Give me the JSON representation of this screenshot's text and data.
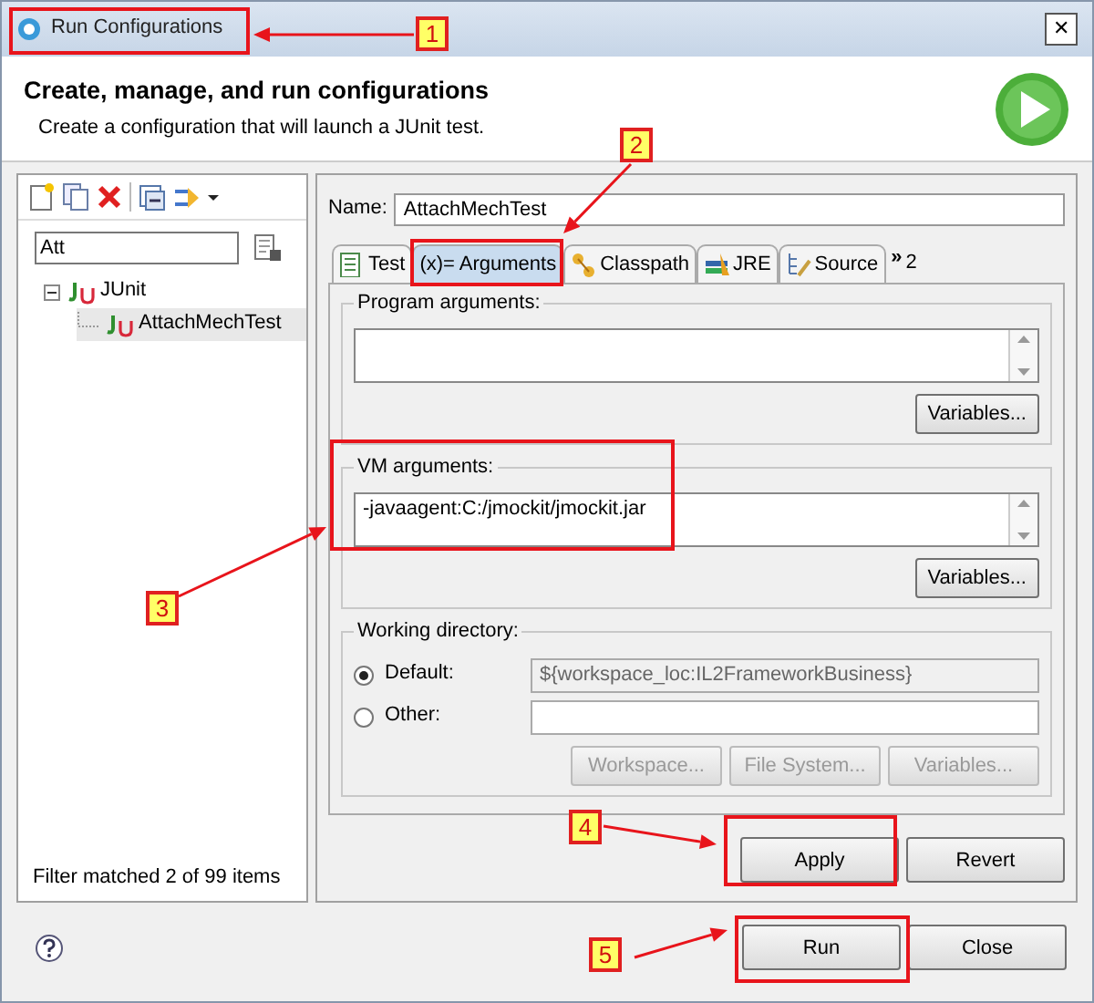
{
  "window": {
    "title": "Run Configurations",
    "close": "✕"
  },
  "header": {
    "title": "Create, manage, and run configurations",
    "description": "Create a configuration that will launch a JUnit test."
  },
  "sidebar": {
    "filter": {
      "value": "Att"
    },
    "tree": [
      {
        "label": "JUnit",
        "expanded": true,
        "selected": false,
        "children": [
          {
            "label": "AttachMechTest",
            "selected": true
          }
        ]
      }
    ],
    "status": "Filter matched 2 of 99 items"
  },
  "name": {
    "label": "Name:",
    "value": "AttachMechTest"
  },
  "tabs": [
    {
      "label": "Test",
      "selected": false
    },
    {
      "label": "(x)= Arguments",
      "selected": true
    },
    {
      "label": "Classpath",
      "selected": false
    },
    {
      "label": "JRE",
      "selected": false
    },
    {
      "label": "Source",
      "selected": false
    }
  ],
  "tabs_overflow": {
    "mark": "»",
    "count": "2"
  },
  "program_arguments": {
    "label": "Program arguments:",
    "button": "Variables..."
  },
  "vm_arguments": {
    "label": "VM arguments:",
    "value": "-javaagent:C:/jmockit/jmockit.jar",
    "button": "Variables..."
  },
  "working_directory": {
    "label": "Working directory:",
    "options": [
      {
        "label": "Default:",
        "selected": true,
        "value": "${workspace_loc:IL2FrameworkBusiness}",
        "disabled": true
      },
      {
        "label": "Other:",
        "selected": false,
        "disabled": false
      }
    ],
    "buttons": [
      {
        "label": "Workspace...",
        "disabled": true
      },
      {
        "label": "File System...",
        "disabled": true
      },
      {
        "label": "Variables...",
        "disabled": true
      }
    ]
  },
  "form_buttons": [
    {
      "label": "Apply"
    },
    {
      "label": "Revert"
    }
  ],
  "dialog_buttons": [
    {
      "label": "Run"
    },
    {
      "label": "Close"
    }
  ],
  "annotations": [
    {
      "label": "1"
    },
    {
      "label": "2"
    },
    {
      "label": "3"
    },
    {
      "label": "4"
    },
    {
      "label": "5"
    }
  ]
}
